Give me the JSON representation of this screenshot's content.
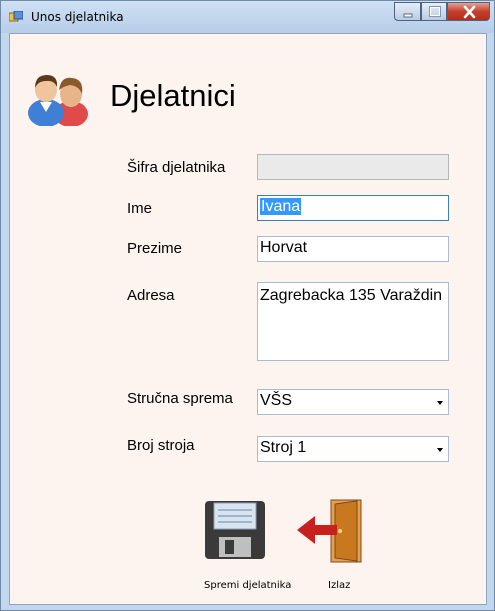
{
  "window": {
    "title": "Unos djelatnika"
  },
  "header": {
    "title": "Djelatnici",
    "icon": "people-icon"
  },
  "form": {
    "sifra_label": "Šifra djelatnika",
    "sifra_value": "",
    "ime_label": "Ime",
    "ime_value": "Ivana",
    "prezime_label": "Prezime",
    "prezime_value": "Horvat",
    "adresa_label": "Adresa",
    "adresa_value": "Zagrebacka 135 Varaždin",
    "sprema_label": "Stručna sprema",
    "sprema_value": "VŠS",
    "stroj_label": "Broj stroja",
    "stroj_value": "Stroj 1"
  },
  "actions": {
    "save_label": "Spremi djelatnika",
    "save_icon": "floppy-disk-icon",
    "exit_label": "Izlaz",
    "exit_icon": "exit-door-icon"
  },
  "colors": {
    "selection": "#3399ff",
    "client_bg": "#fdf4ef",
    "close_red": "#c4402d"
  }
}
